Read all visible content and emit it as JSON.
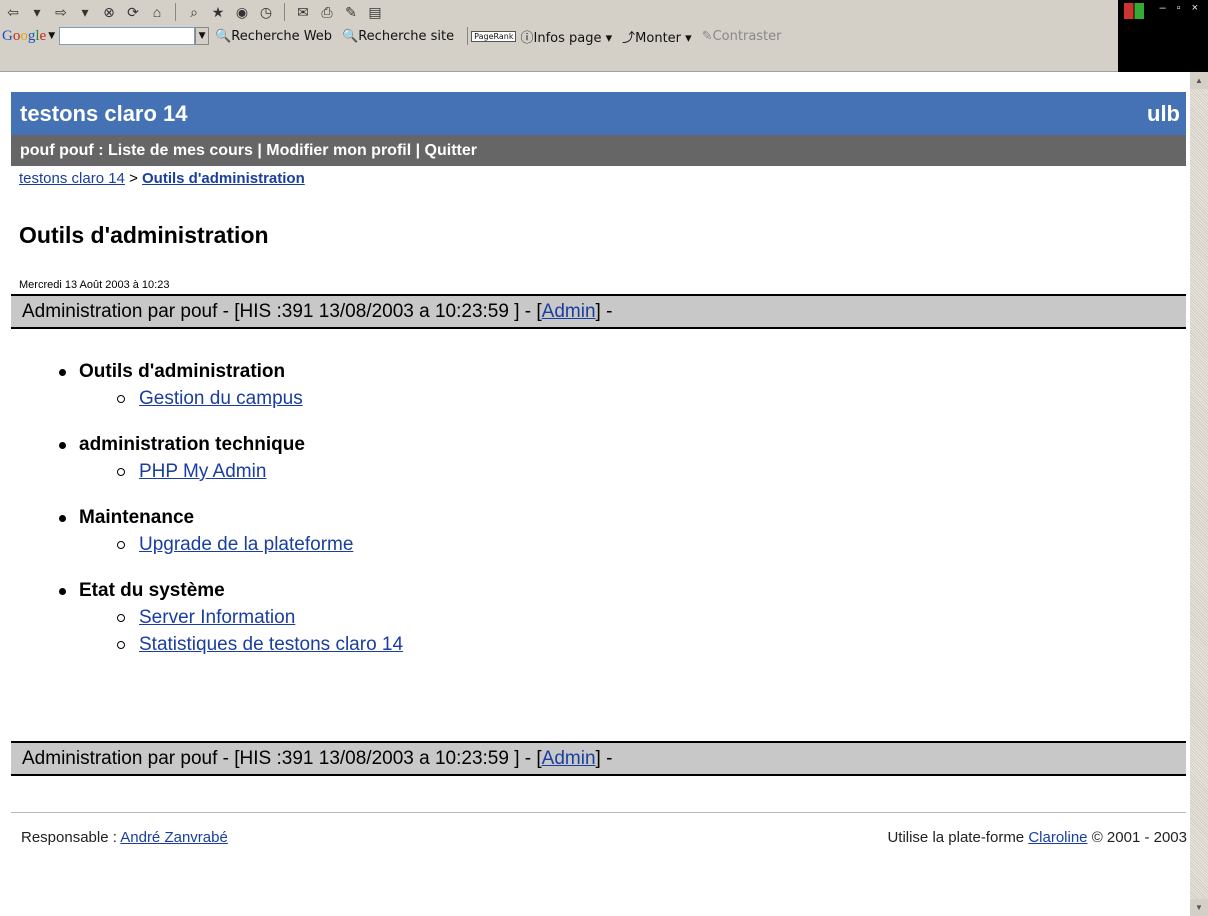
{
  "browser": {
    "google_bar": {
      "logo": "Google",
      "search_value": "",
      "buttons": [
        "Recherche Web",
        "Recherche site",
        "Infos page",
        "Monter",
        "Contraster"
      ],
      "pagerank_label": "PageRank"
    }
  },
  "header": {
    "site_name": "testons claro 14",
    "institution": "ulb"
  },
  "userbar": {
    "user": "pouf pouf",
    "separator": " : ",
    "links": [
      "Liste de mes cours",
      "Modifier mon profil",
      "Quitter"
    ],
    "pipe": " | "
  },
  "breadcrumb": {
    "home": "testons claro 14",
    "arrow": " > ",
    "current": "Outils d'administration"
  },
  "page": {
    "title": "Outils d'administration",
    "date": "Mercredi 13 Août 2003 à 10:23"
  },
  "adminbar": {
    "prefix": "Administration par pouf - [HIS :391 13/08/2003 a 10:23:59 ] - [",
    "link": "Admin",
    "suffix": "] -"
  },
  "menu": [
    {
      "title": "Outils d'administration",
      "items": [
        "Gestion du campus"
      ]
    },
    {
      "title": "administration technique",
      "items": [
        "PHP My Admin"
      ]
    },
    {
      "title": "Maintenance",
      "items": [
        "Upgrade de la plateforme"
      ]
    },
    {
      "title": "Etat du système",
      "items": [
        "Server Information",
        "Statistiques de testons claro 14"
      ]
    }
  ],
  "footer": {
    "resp_label": "Responsable : ",
    "resp_name": "André Zanvrabé",
    "platform_prefix": "Utilise la plate-forme ",
    "platform_link": "Claroline",
    "platform_suffix": " © 2001 - 2003"
  }
}
